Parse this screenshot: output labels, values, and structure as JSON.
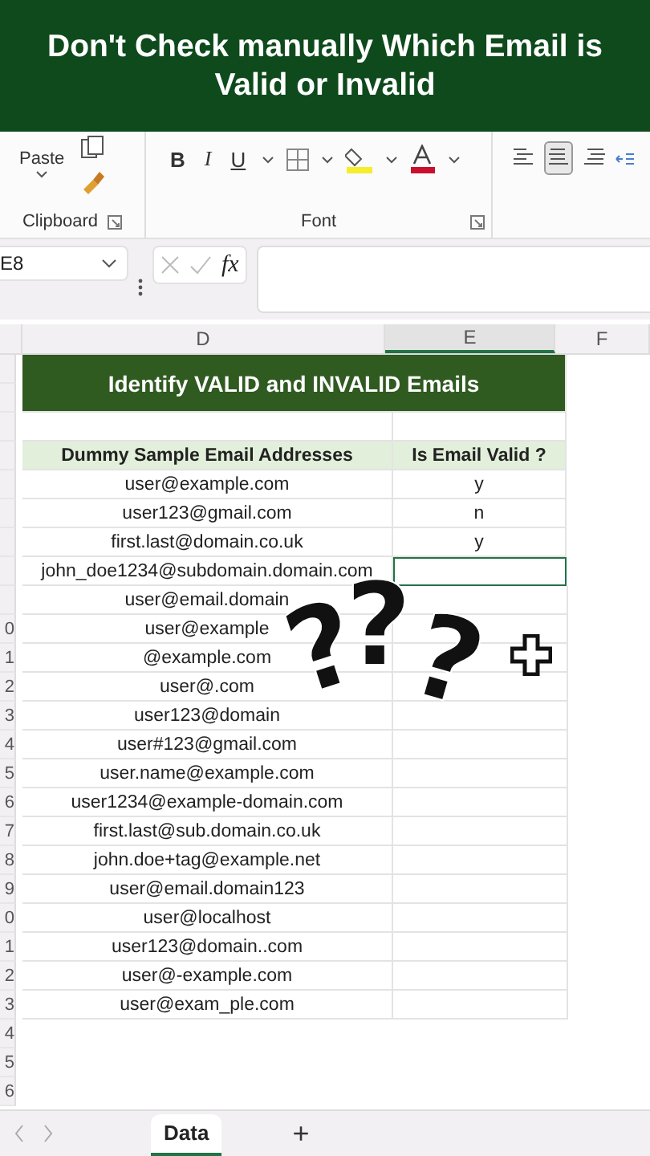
{
  "banner": {
    "title": "Don't Check manually Which Email is Valid or Invalid"
  },
  "ribbon": {
    "paste": "Paste",
    "groups": [
      {
        "label": "Clipboard"
      },
      {
        "label": "Font"
      }
    ],
    "font_buttons": [
      "B",
      "I",
      "U"
    ],
    "alignment": [
      {
        "selected": false
      },
      {
        "selected": true
      },
      {
        "selected": false
      }
    ]
  },
  "formula_bar": {
    "name_box": "E8",
    "function_label": "fx"
  },
  "sheet": {
    "columns": [
      {
        "label": "D",
        "selected": false
      },
      {
        "label": "E",
        "selected": true
      },
      {
        "label": "F",
        "selected": false
      }
    ],
    "title": "Identify VALID and INVALID Emails",
    "headers": [
      "Dummy Sample Email Addresses",
      "Is Email Valid ?"
    ],
    "rows": [
      {
        "email": "user@example.com",
        "valid": "y",
        "selected": false
      },
      {
        "email": "user123@gmail.com",
        "valid": "n",
        "selected": false
      },
      {
        "email": "first.last@domain.co.uk",
        "valid": "y",
        "selected": false
      },
      {
        "email": "john_doe1234@subdomain.domain.com",
        "selected": true
      },
      {
        "email": "user@email.domain",
        "selected": false
      },
      {
        "email": "user@example",
        "selected": false,
        "row_label": "0"
      },
      {
        "email": "@example.com",
        "selected": false,
        "row_label": "1"
      },
      {
        "email": "user@.com",
        "selected": false,
        "row_label": "2"
      },
      {
        "email": "user123@domain",
        "selected": false,
        "row_label": "3"
      },
      {
        "email": "user#123@gmail.com",
        "selected": false,
        "row_label": "4"
      },
      {
        "email": "user.name@example.com",
        "selected": false,
        "row_label": "5"
      },
      {
        "email": "user1234@example-domain.com",
        "selected": false,
        "row_label": "6"
      },
      {
        "email": "first.last@sub.domain.co.uk",
        "selected": false,
        "row_label": "7"
      },
      {
        "email": "john.doe+tag@example.net",
        "selected": false,
        "row_label": "8"
      },
      {
        "email": "user@email.domain123",
        "selected": false,
        "row_label": "9"
      },
      {
        "email": "user@localhost",
        "selected": false,
        "row_label": "0"
      },
      {
        "email": "user123@domain..com",
        "selected": false,
        "row_label": "1"
      },
      {
        "email": "user@-example.com",
        "selected": false,
        "row_label": "2"
      },
      {
        "email": "user@exam_ple.com",
        "selected": false,
        "row_label": "3"
      }
    ],
    "blank_rows": [
      {
        "row_label": "4"
      },
      {
        "row_label": "5"
      },
      {
        "row_label": "6"
      }
    ],
    "overlay_marks": [
      "?",
      "?",
      "?"
    ]
  },
  "sheet_tabs": [
    {
      "label": "Data",
      "selected": true
    }
  ],
  "add_sheet": "+"
}
